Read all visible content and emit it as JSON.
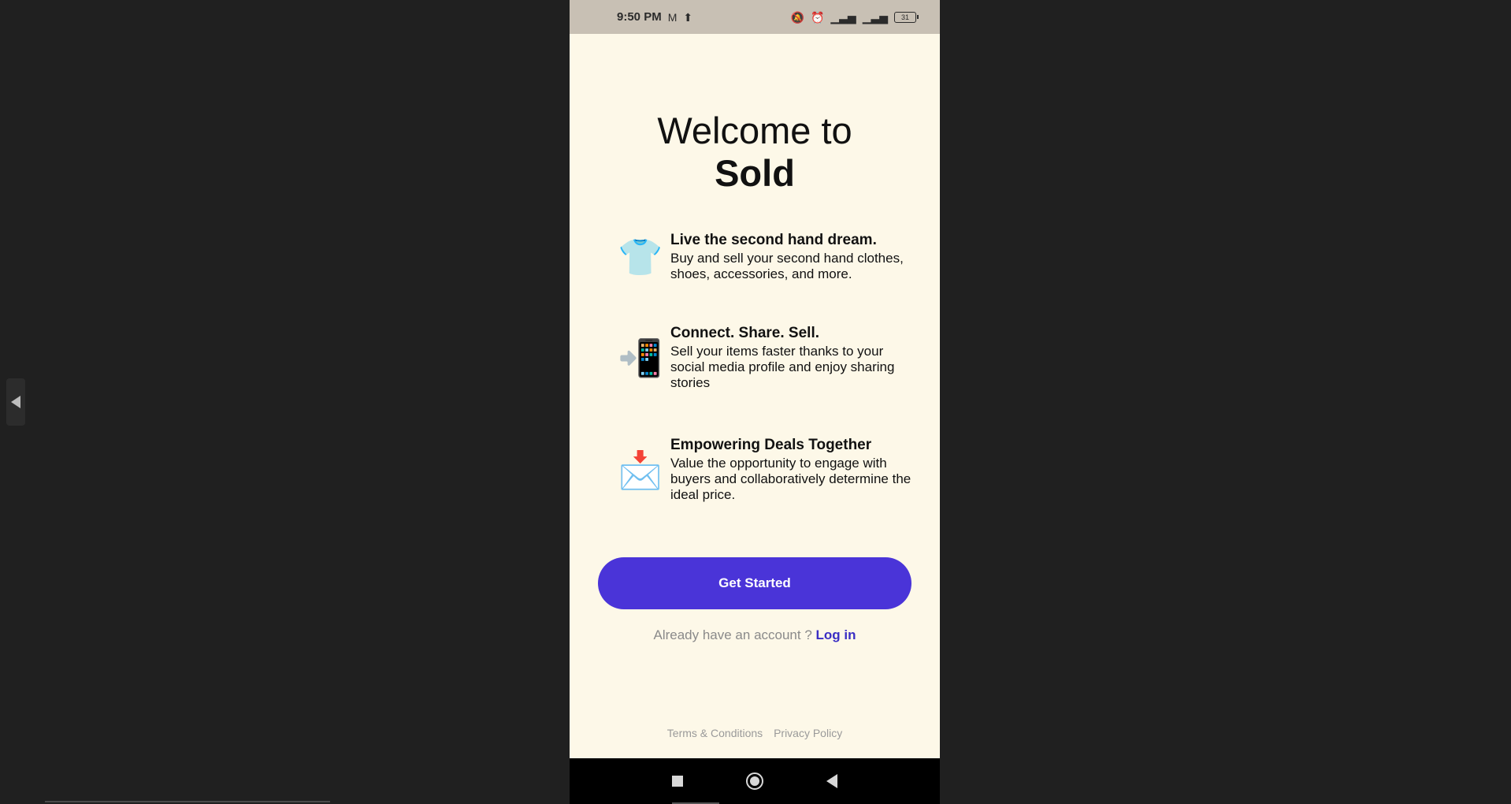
{
  "status_bar": {
    "time": "9:50 PM",
    "battery": "31",
    "icons": [
      "gmail-icon",
      "upload-icon",
      "mute-icon",
      "alarm-icon",
      "signal-icon",
      "signal-icon"
    ]
  },
  "welcome": {
    "line1": "Welcome to",
    "line2": "Sold"
  },
  "features": [
    {
      "icon": "tshirt-icon",
      "emoji": "👕",
      "title": "Live the second hand dream.",
      "description": "Buy and sell your second hand clothes, shoes, accessories, and more."
    },
    {
      "icon": "mobile-arrow-icon",
      "emoji": "📲",
      "title": "Connect. Share. Sell.",
      "description": "Sell your items faster thanks to your social media profile and enjoy sharing stories"
    },
    {
      "icon": "envelope-arrow-icon",
      "emoji": "📩",
      "title": "Empowering Deals Together",
      "description": "Value the opportunity to engage with buyers and collaboratively determine the ideal price."
    }
  ],
  "actions": {
    "get_started": "Get Started",
    "login_prompt": "Already have an account ?",
    "login_link": "Log in"
  },
  "footer": {
    "terms": "Terms & Conditions",
    "privacy": "Privacy Policy"
  },
  "colors": {
    "background": "#fdf8e8",
    "accent": "#4a34d8",
    "link": "#3b2fc4"
  }
}
